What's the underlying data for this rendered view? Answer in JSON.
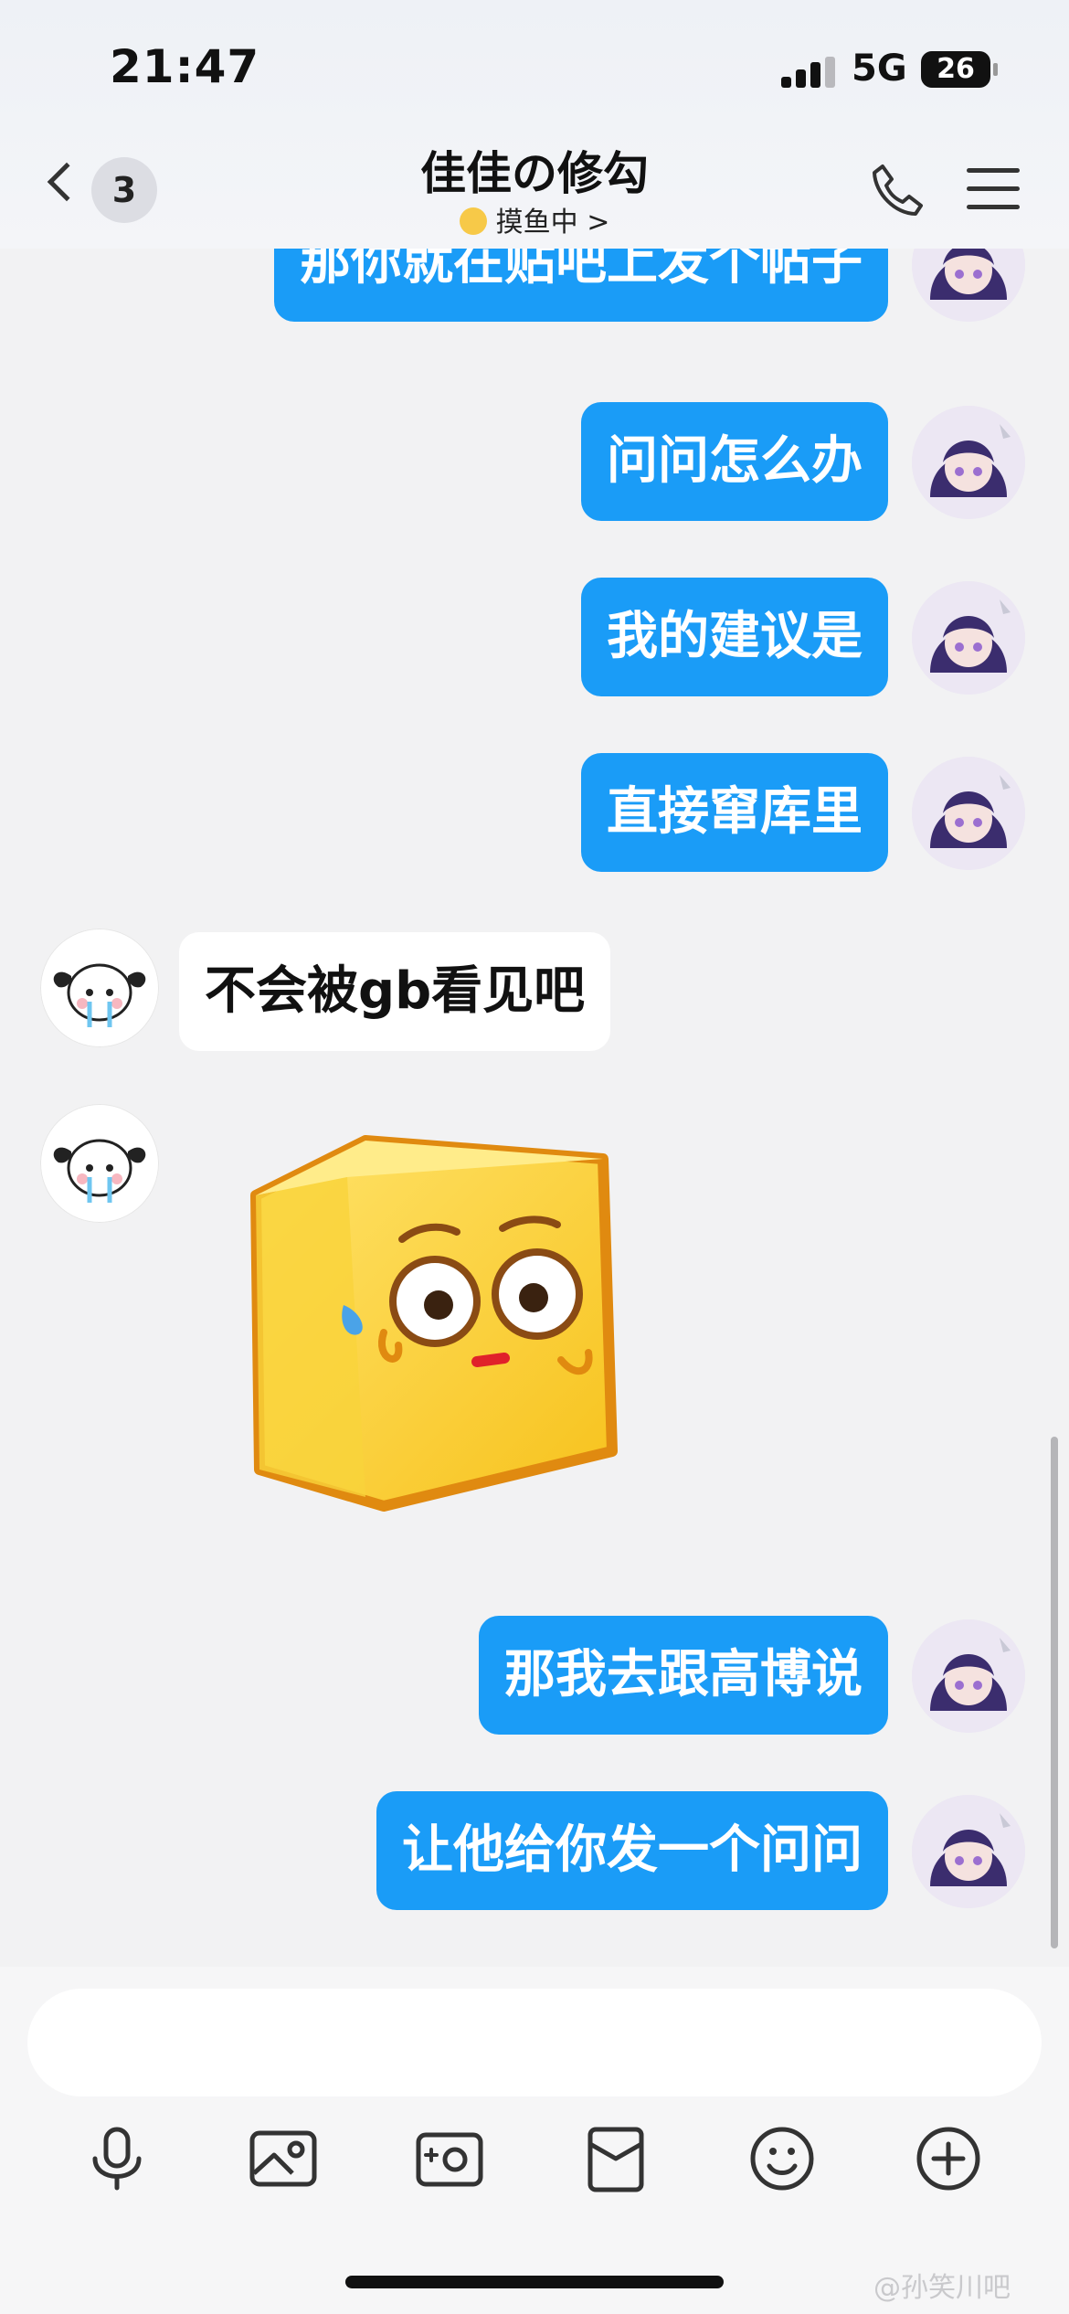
{
  "status_bar": {
    "time": "21:47",
    "network": "5G",
    "battery": "26"
  },
  "header": {
    "back_count": "3",
    "title": "佳佳の修勾",
    "subtitle": "摸鱼中 >",
    "icons": [
      "back-chevron-icon",
      "phone-icon",
      "menu-icon"
    ]
  },
  "messages": [
    {
      "from": "me",
      "text": "那你就在贴吧上发个帖子"
    },
    {
      "from": "me",
      "text": "问问怎么办"
    },
    {
      "from": "me",
      "text": "我的建议是"
    },
    {
      "from": "me",
      "text": "直接窜库里"
    },
    {
      "from": "other",
      "text": "不会被gb看见吧"
    },
    {
      "from": "other",
      "sticker": "yellow-cube-sweat-sticker"
    },
    {
      "from": "me",
      "text": "那我去跟高博说"
    },
    {
      "from": "me",
      "text": "让他给你发一个问问"
    }
  ],
  "input": {
    "value": "",
    "placeholder": ""
  },
  "toolbar": [
    "microphone-icon",
    "image-icon",
    "camera-icon",
    "red-packet-icon",
    "emoji-icon",
    "plus-icon"
  ],
  "watermark": "@孙笑川吧",
  "colors": {
    "outgoing_bubble": "#1a9cf7",
    "incoming_bubble": "#ffffff",
    "background": "#f2f2f3"
  }
}
